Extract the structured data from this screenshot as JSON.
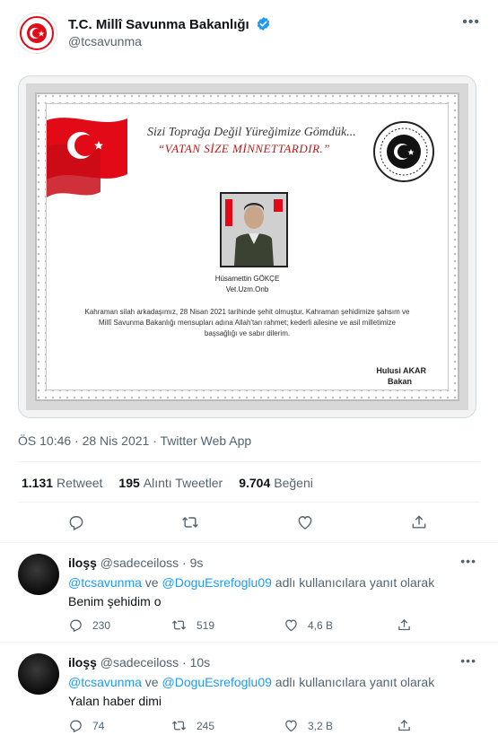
{
  "tweet": {
    "author_name": "T.C. Millî Savunma Bakanlığı",
    "author_handle": "@tcsavunma",
    "timestamp": "ÖS 10:46 · 28 Nis 2021 · Twitter Web App",
    "media": {
      "motto_line1": "Sizi Toprağa Değil Yüreğimize Gömdük...",
      "motto_line2": "“VATAN SİZE MİNNETTARDIR.”",
      "soldier_name": "Hüsamettin GÖKÇE",
      "soldier_rank": "Vet.Uzm.Onb",
      "condolence": "Kahraman silah arkadaşımız, 28 Nisan 2021 tarihinde şehit olmuştur. Kahraman şehidimize şahsım ve Millî Savunma Bakanlığı mensupları adına Allah'tan rahmet; kederli ailesine ve asil milletimize başsağlığı ve sabır dilerim.",
      "signer_name": "Hulusi AKAR",
      "signer_title": "Bakan"
    },
    "stats": {
      "retweets_count": "1.131",
      "retweets_label": "Retweet",
      "quotes_count": "195",
      "quotes_label": "Alıntı Tweetler",
      "likes_count": "9.704",
      "likes_label": "Beğeni"
    }
  },
  "replies": [
    {
      "name": "iloşş",
      "handle": "@sadeceiloss · 9s",
      "reply_mention1": "@tcsavunma",
      "reply_connector": " ve ",
      "reply_mention2": "@DoguEsrefoglu09",
      "reply_suffix": " adlı kullanıcılara yanıt olarak",
      "text": "Benim şehidim o",
      "reply_count": "230",
      "retweet_count": "519",
      "like_count": "4,6 B"
    },
    {
      "name": "iloşş",
      "handle": "@sadeceiloss · 10s",
      "reply_mention1": "@tcsavunma",
      "reply_connector": " ve ",
      "reply_mention2": "@DoguEsrefoglu09",
      "reply_suffix": " adlı kullanıcılara yanıt olarak",
      "text": "Yalan haber dimi",
      "reply_count": "74",
      "retweet_count": "245",
      "like_count": "3,2 B"
    }
  ],
  "colors": {
    "accent": "#1d9bf0",
    "secondary_text": "#536471",
    "flag_red": "#e30a17"
  },
  "icons": [
    "mod-logo-icon",
    "verified-badge-icon",
    "more-icon",
    "reply-icon",
    "retweet-icon",
    "like-icon",
    "share-icon"
  ]
}
